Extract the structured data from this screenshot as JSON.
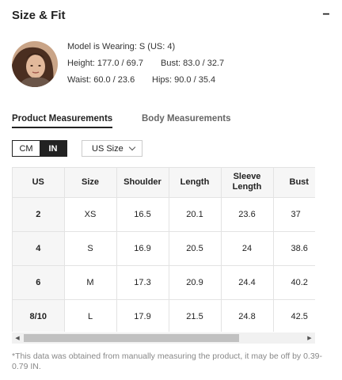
{
  "section": {
    "title": "Size & Fit",
    "collapse_symbol": "−"
  },
  "model": {
    "wearing": "Model is Wearing: S (US: 4)",
    "height": "Height: 177.0 / 69.7",
    "bust": "Bust: 83.0 / 32.7",
    "waist": "Waist: 60.0 / 23.6",
    "hips": "Hips: 90.0 / 35.4"
  },
  "tabs": [
    {
      "label": "Product Measurements",
      "active": true
    },
    {
      "label": "Body Measurements",
      "active": false
    }
  ],
  "units": {
    "cm": "CM",
    "in": "IN",
    "selected": "IN"
  },
  "size_select": {
    "value": "US Size"
  },
  "table": {
    "headers": [
      "US",
      "Size",
      "Shoulder",
      "Length",
      "Sleeve Length",
      "Bust"
    ],
    "rows": [
      [
        "2",
        "XS",
        "16.5",
        "20.1",
        "23.6",
        "37"
      ],
      [
        "4",
        "S",
        "16.9",
        "20.5",
        "24",
        "38.6"
      ],
      [
        "6",
        "M",
        "17.3",
        "20.9",
        "24.4",
        "40.2"
      ],
      [
        "8/10",
        "L",
        "17.9",
        "21.5",
        "24.8",
        "42.5"
      ]
    ]
  },
  "scrollbar": {
    "left_arrow": "◀",
    "right_arrow": "▶",
    "visible_fraction": 0.72
  },
  "footnote": "*This data was obtained from manually measuring the product, it may be off by 0.39-0.79 IN."
}
